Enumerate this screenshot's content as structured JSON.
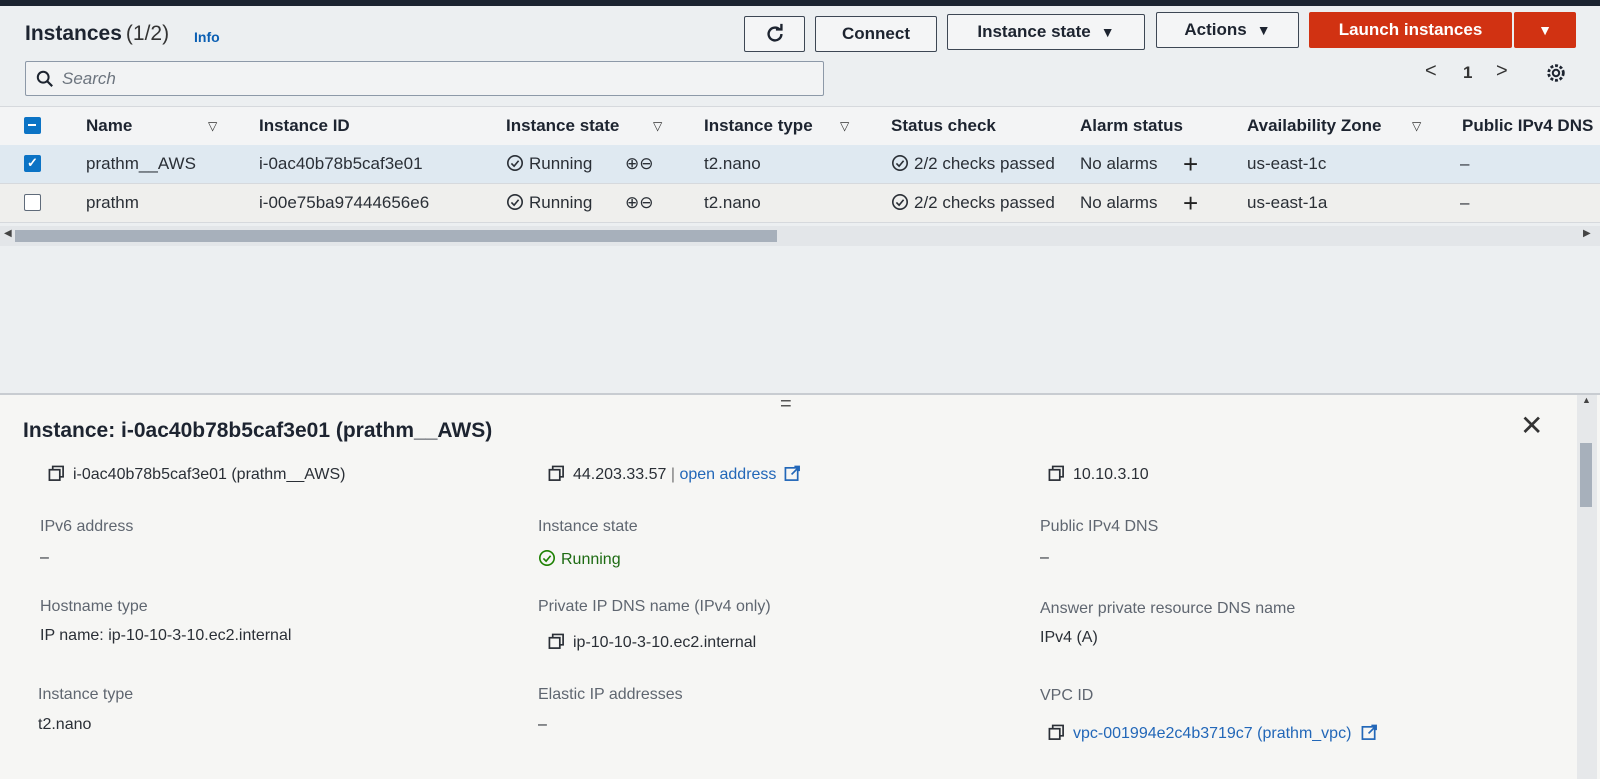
{
  "header": {
    "title": "Instances",
    "count": "(1/2)",
    "info": "Info",
    "connect": "Connect",
    "instance_state": "Instance state",
    "actions": "Actions",
    "launch": "Launch instances"
  },
  "search": {
    "placeholder": "Search"
  },
  "pagination": {
    "page": "1"
  },
  "table": {
    "columns": [
      "Name",
      "Instance ID",
      "Instance state",
      "Instance type",
      "Status check",
      "Alarm status",
      "Availability Zone",
      "Public IPv4 DNS"
    ],
    "rows": [
      {
        "selected": true,
        "name": "prathm__AWS",
        "id": "i-0ac40b78b5caf3e01",
        "state": "Running",
        "type": "t2.nano",
        "status": "2/2 checks passed",
        "alarm": "No alarms",
        "az": "us-east-1c",
        "dns": "–"
      },
      {
        "selected": false,
        "name": "prathm",
        "id": "i-00e75ba97444656e6",
        "state": "Running",
        "type": "t2.nano",
        "status": "2/2 checks passed",
        "alarm": "No alarms",
        "az": "us-east-1a",
        "dns": "–"
      }
    ]
  },
  "detail": {
    "title": "Instance: i-0ac40b78b5caf3e01 (prathm__AWS)",
    "instance_id_value": "i-0ac40b78b5caf3e01 (prathm__AWS)",
    "public_ip": "44.203.33.57",
    "separator": " | ",
    "open_address": "open address",
    "private_ip": "10.10.3.10",
    "ipv6_label": "IPv6 address",
    "ipv6_value": "–",
    "state_label": "Instance state",
    "state_value": "Running",
    "public_dns_label": "Public IPv4 DNS",
    "public_dns_value": "–",
    "hostname_label": "Hostname type",
    "hostname_value": "IP name: ip-10-10-3-10.ec2.internal",
    "private_dns_label": "Private IP DNS name (IPv4 only)",
    "private_dns_value": "ip-10-10-3-10.ec2.internal",
    "answer_label": "Answer private resource DNS name",
    "answer_value": "IPv4 (A)",
    "type_label": "Instance type",
    "type_value": "t2.nano",
    "elastic_label": "Elastic IP addresses",
    "elastic_value": "–",
    "vpc_label": "VPC ID",
    "vpc_value": "vpc-001994e2c4b3719c7 (prathm_vpc)"
  },
  "colors": {
    "primary": "#d13212",
    "link": "#0b73c5",
    "success": "#1d8102"
  }
}
